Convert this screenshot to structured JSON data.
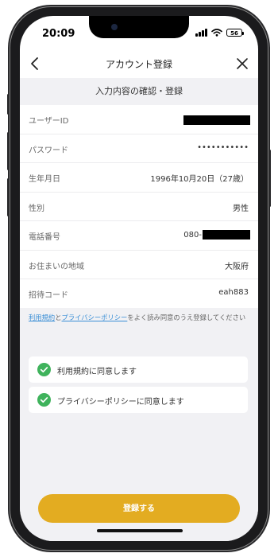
{
  "status": {
    "time": "20:09",
    "battery": "56"
  },
  "nav": {
    "title": "アカウント登録"
  },
  "section": {
    "title": "入力内容の確認・登録"
  },
  "fields": [
    {
      "label": "ユーザーID",
      "value": ""
    },
    {
      "label": "パスワード",
      "value": "•••••••••••"
    },
    {
      "label": "生年月日",
      "value": "1996年10月20日（27歳）"
    },
    {
      "label": "性別",
      "value": "男性"
    },
    {
      "label": "電話番号",
      "value": "080-"
    },
    {
      "label": "お住まいの地域",
      "value": "大阪府"
    },
    {
      "label": "招待コード",
      "value": "eah883"
    }
  ],
  "notice": {
    "link1": "利用規約",
    "connector": "と",
    "link2": "プライバシーポリシー",
    "text": "をよく読み同意のうえ登録してください"
  },
  "consents": [
    {
      "label": "利用規約に同意します",
      "checked": true
    },
    {
      "label": "プライバシーポリシーに同意します",
      "checked": true
    }
  ],
  "submit_label": "登録する",
  "colors": {
    "accent": "#e3ac21",
    "check": "#3fb35c",
    "link": "#3b8fd6",
    "section_bg": "#f1f1f4"
  }
}
